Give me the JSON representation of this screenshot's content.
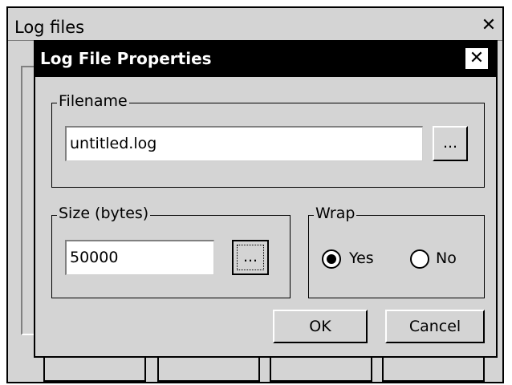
{
  "background_window": {
    "title": "Log files",
    "close_glyph": "✕",
    "close_icon": "close-icon"
  },
  "dialog": {
    "title": "Log File Properties",
    "close_glyph": "✕",
    "close_icon": "close-icon",
    "filename_group": {
      "legend": "Filename",
      "value": "untitled.log",
      "browse_label": "..."
    },
    "size_group": {
      "legend": "Size (bytes)",
      "value": "50000",
      "browse_label": "..."
    },
    "wrap_group": {
      "legend": "Wrap",
      "options": [
        {
          "label": "Yes",
          "selected": true
        },
        {
          "label": "No",
          "selected": false
        }
      ]
    },
    "ok_label": "OK",
    "cancel_label": "Cancel"
  }
}
